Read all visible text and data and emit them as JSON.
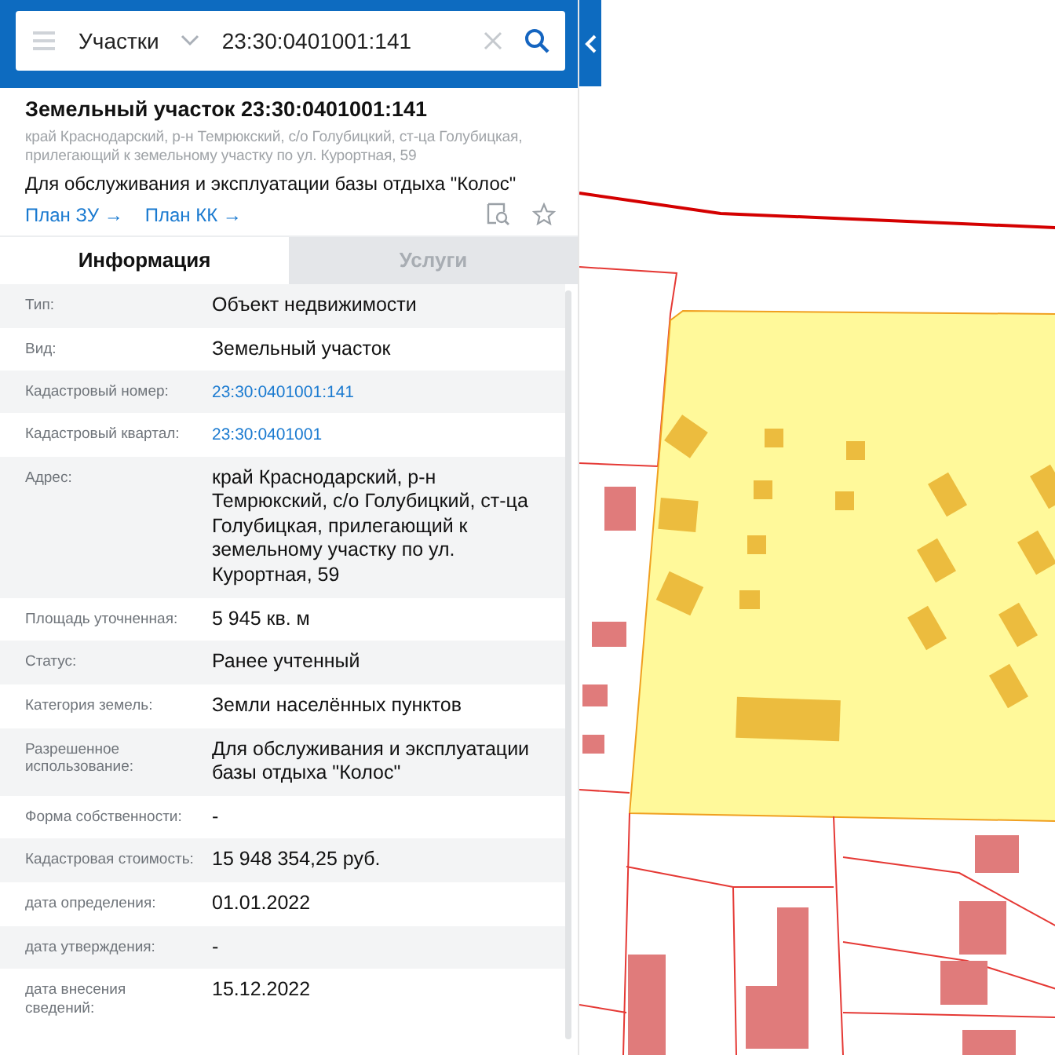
{
  "search": {
    "category": "Участки",
    "value": "23:30:0401001:141"
  },
  "object": {
    "title": "Земельный участок 23:30:0401001:141",
    "address": "край Краснодарский, р-н Темрюкский, с/о Голубицкий, ст-ца Голубицкая, прилегающий к земельному участку по ул. Курортная, 59",
    "purpose": "Для обслуживания и эксплуатации базы отдыха \"Колос\"",
    "links": [
      "План ЗУ →",
      "План КК →"
    ]
  },
  "tabs": [
    {
      "label": "Информация",
      "selected": true
    },
    {
      "label": "Услуги",
      "selected": false
    }
  ],
  "rows": [
    {
      "label": "Тип:",
      "value": "Объект недвижимости",
      "kind": "text"
    },
    {
      "label": "Вид:",
      "value": "Земельный участок",
      "kind": "text"
    },
    {
      "label": "Кадастровый номер:",
      "value": "23:30:0401001:141",
      "kind": "link"
    },
    {
      "label": "Кадастровый квартал:",
      "value": "23:30:0401001",
      "kind": "link"
    },
    {
      "label": "Адрес:",
      "value": "край Краснодарский, р-н Темрюкский, с/о Голубицкий, ст-ца Голубицкая, прилегающий к земельному участку по ул. Курортная, 59",
      "kind": "text"
    },
    {
      "label": "Площадь уточненная:",
      "value": "5 945 кв. м",
      "kind": "text"
    },
    {
      "label": "Статус:",
      "value": "Ранее учтенный",
      "kind": "text"
    },
    {
      "label": "Категория земель:",
      "value": "Земли населённых пунктов",
      "kind": "text"
    },
    {
      "label": "Разрешенное использование:",
      "value": "Для обслуживания и эксплуатации базы отдыха \"Колос\"",
      "kind": "text"
    },
    {
      "label": "Форма собственности:",
      "value": "-",
      "kind": "text"
    },
    {
      "label": "Кадастровая стоимость:",
      "value": "15 948 354,25 руб.",
      "kind": "text"
    },
    {
      "label": "дата определения:",
      "value": "01.01.2022",
      "kind": "text"
    },
    {
      "label": "дата утверждения:",
      "value": "-",
      "kind": "text"
    },
    {
      "label": "дата внесения сведений:",
      "value": "15.12.2022",
      "kind": "text"
    }
  ]
}
